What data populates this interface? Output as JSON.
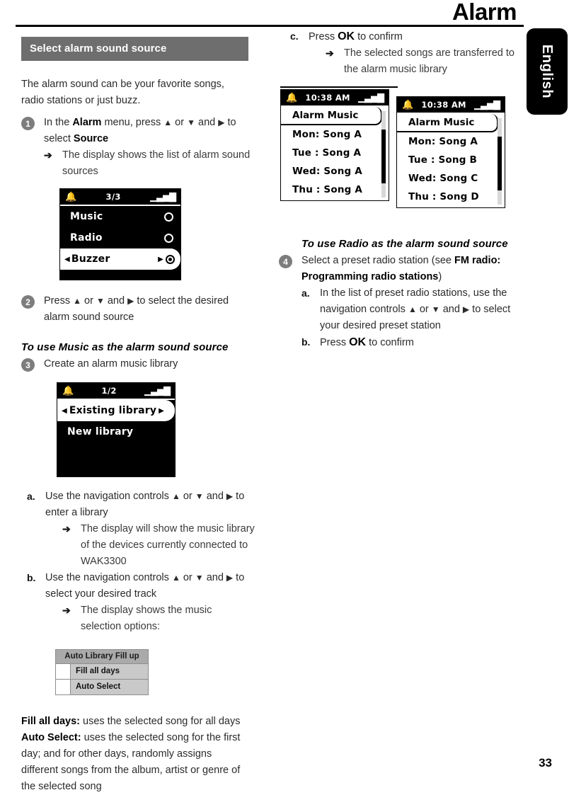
{
  "page": {
    "title": "Alarm",
    "language_tab": "English",
    "number": "33"
  },
  "left_column": {
    "section_heading": "Select alarm sound source",
    "intro": "The alarm sound can be your favorite songs, radio stations or just buzz.",
    "step1": {
      "num": "1",
      "text_a": "In the ",
      "bold_a": "Alarm",
      "text_b": " menu, press ",
      "nav_a": "▲",
      "text_c": " or ",
      "nav_b": "▼",
      "text_d": " and ",
      "nav_c": "▶",
      "text_e": " to select ",
      "bold_b": "Source",
      "result": "The display shows the list of alarm sound sources",
      "arrow": "➔"
    },
    "lcd_source": {
      "bell_icon": "▲",
      "page_indicator": "3/3",
      "signal_icon": "signal-bars",
      "rows": [
        {
          "label": "Music",
          "selected": false,
          "radio": "off"
        },
        {
          "label": "Radio",
          "selected": false,
          "radio": "off"
        },
        {
          "label": "Buzzer",
          "selected": true,
          "radio": "on",
          "left_caret": "◀",
          "right_caret": "▶"
        }
      ]
    },
    "step2": {
      "num": "2",
      "text_a": "Press ",
      "nav_a": "▲",
      "text_b": " or ",
      "nav_b": "▼",
      "text_c": " and ",
      "nav_c": "▶",
      "text_d": " to select the desired alarm sound source"
    },
    "music_heading": "To use Music as the alarm sound source",
    "step3": {
      "num": "3",
      "text": "Create an alarm music library"
    },
    "lcd_library": {
      "page_indicator": "1/2",
      "rows": [
        {
          "label": "Existing library",
          "selected": true,
          "left_caret": "◀",
          "right_caret": "▶"
        },
        {
          "label": "New library",
          "selected": false
        }
      ]
    },
    "substep_a": {
      "letter": "a.",
      "text_a": "Use the navigation controls ",
      "nav_a": "▲",
      "text_b": " or ",
      "nav_b": "▼",
      "text_c": " and ",
      "nav_c": "▶",
      "text_d": " to enter a library",
      "result": "The display will show the music library of the devices currently connected to WAK3300",
      "arrow": "➔"
    },
    "substep_b": {
      "letter": "b.",
      "text_a": "Use the navigation controls ",
      "nav_a": "▲",
      "text_b": " or ",
      "nav_b": "▼",
      "text_c": " and ",
      "nav_c": "▶",
      "text_d": " to select your desired track",
      "result": "The display shows the music selection options:",
      "arrow": "➔"
    },
    "auto_library": {
      "title": "Auto Library Fill up",
      "items": [
        "Fill all days",
        "Auto Select"
      ]
    },
    "explain": {
      "term1": "Fill all days:",
      "def1": " uses the selected song for all days",
      "term2": "Auto Select:",
      "def2": " uses the selected song for the first day; and for other days, randomly assigns different songs from the album, artist or genre of the selected song"
    }
  },
  "right_column": {
    "substep_c": {
      "letter": "c.",
      "text_a": "Press ",
      "bold_a": "OK",
      "text_b": " to confirm",
      "result": "The selected songs are transferred to the alarm music library",
      "arrow": "➔"
    },
    "lcd_alarm_music_1": {
      "page_indicator": "10:38 AM",
      "title": "Alarm Music",
      "rows": [
        "Mon: Song A",
        "Tue : Song A",
        "Wed: Song A",
        "Thu : Song A"
      ]
    },
    "lcd_alarm_music_2": {
      "page_indicator": "10:38 AM",
      "title": "Alarm Music",
      "rows": [
        "Mon: Song A",
        "Tue : Song B",
        "Wed: Song C",
        "Thu : Song D"
      ]
    },
    "radio_heading": "To use Radio as the alarm sound source",
    "step4": {
      "num": "4",
      "text_a": "Select a preset radio station (see ",
      "bold_a": "FM radio: Programming radio stations",
      "text_b": ")"
    },
    "substep_a": {
      "letter": "a.",
      "text_a": "In the list of preset radio stations, use the navigation controls ",
      "nav_a": "▲",
      "text_b": " or ",
      "nav_b": "▼",
      "text_c": " and ",
      "nav_c": "▶",
      "text_d": " to select your desired preset station"
    },
    "substep_b": {
      "letter": "b.",
      "text_a": "Press ",
      "bold_a": "OK",
      "text_b": " to confirm"
    }
  }
}
